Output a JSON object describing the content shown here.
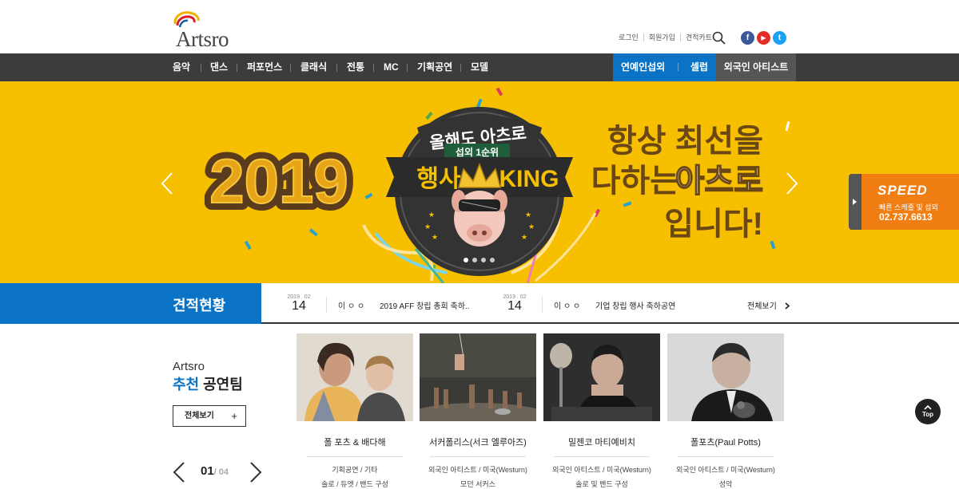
{
  "brand": {
    "logo_text": "Artsro"
  },
  "util": {
    "login": "로그인",
    "join": "회원가입",
    "cart": "견적카트"
  },
  "sns": {
    "facebook": "f",
    "youtube": "▶",
    "twitter": "t"
  },
  "colors": {
    "accent_blue": "#0a73c5",
    "banner_yellow": "#f6c000",
    "nav_dark": "#3c3c3c",
    "speed_orange": "#f07e12"
  },
  "nav": {
    "items": [
      "음악",
      "댄스",
      "퍼포먼스",
      "클래식",
      "전통",
      "MC",
      "기획공연",
      "모델"
    ],
    "right": [
      "연예인섭외",
      "셀럽",
      "외국인 아티스트"
    ]
  },
  "banner": {
    "year": "2019",
    "badge_top": "올해도 아츠로",
    "badge_ribbon": "섭외 1순위",
    "badge_main_left": "행사",
    "badge_main_right": "KING",
    "headline_1": "항상 최선을",
    "headline_2a": "다하는",
    "headline_2b": "아츠로",
    "headline_3": "입니다!",
    "slides": 4,
    "active_slide": 1
  },
  "speed": {
    "title": "SPEED",
    "subtitle": "빠른 스케줄 및 섭외",
    "phone": "02.737.6613"
  },
  "estimate": {
    "title": "견적현황",
    "entries": [
      {
        "ym": "2019 . 02",
        "day": "14",
        "name": "이 ㅇ ㅇ",
        "event": "2019 AFF 창립 총회 축하.."
      },
      {
        "ym": "2019 . 02",
        "day": "14",
        "name": "이 ㅇ ㅇ",
        "event": "기업 창립 행사 축하공연"
      }
    ],
    "view_all": "전체보기"
  },
  "recommend": {
    "sub": "Artsro",
    "title_em": "추천",
    "title_rest": " 공연팀",
    "view_all": "전체보기",
    "page_current": "01",
    "page_total": "/ 04",
    "cards": [
      {
        "name": "폴 포츠 & 배다해",
        "meta1": "기획공연 / 기타",
        "meta2": "솔로 / 듀엣 / 밴드 구성"
      },
      {
        "name": "서커폴리스(서크 엘루아즈)",
        "meta1": "외국인 아티스트 / 미국(Westurn)",
        "meta2": "모던 서커스"
      },
      {
        "name": "밀젠코 마티예비치",
        "meta1": "외국인 아티스트 / 미국(Westurn)",
        "meta2": "솔로 및 밴드 구성"
      },
      {
        "name": "폴포츠(Paul Potts)",
        "meta1": "외국인 아티스트 / 미국(Westurn)",
        "meta2": "성악"
      }
    ]
  },
  "top_button": "Top"
}
